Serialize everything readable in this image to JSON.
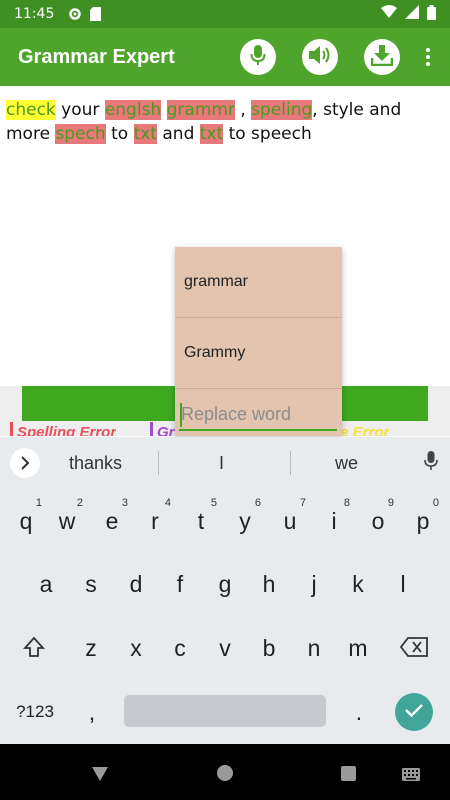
{
  "status_bar": {
    "time": "11:45"
  },
  "app": {
    "title": "Grammar Expert"
  },
  "editor": {
    "words": [
      {
        "text": "check",
        "hl": "yellow"
      },
      {
        "text": " your ",
        "hl": "none"
      },
      {
        "text": "englsh",
        "hl": "red"
      },
      {
        "text": " ",
        "hl": "none"
      },
      {
        "text": "grammr",
        "hl": "red"
      },
      {
        "text": " , ",
        "hl": "none"
      },
      {
        "text": "speling",
        "hl": "red"
      },
      {
        "text": ", style and more ",
        "hl": "none"
      },
      {
        "text": "spech",
        "hl": "red"
      },
      {
        "text": " to ",
        "hl": "none"
      },
      {
        "text": "txt",
        "hl": "red"
      },
      {
        "text": " and ",
        "hl": "none"
      },
      {
        "text": "txt",
        "hl": "red"
      },
      {
        "text": " to speech",
        "hl": "none"
      }
    ]
  },
  "legend": {
    "spelling": "Spelling Error",
    "grammar": "Gr",
    "style": "le Error"
  },
  "popup": {
    "suggestions": [
      "grammar",
      "Grammy"
    ],
    "replace_placeholder": "Replace word",
    "replace_value": ""
  },
  "keyboard": {
    "suggestions": [
      "thanks",
      "I",
      "we"
    ],
    "row1": [
      {
        "key": "q",
        "num": "1"
      },
      {
        "key": "w",
        "num": "2"
      },
      {
        "key": "e",
        "num": "3"
      },
      {
        "key": "r",
        "num": "4"
      },
      {
        "key": "t",
        "num": "5"
      },
      {
        "key": "y",
        "num": "6"
      },
      {
        "key": "u",
        "num": "7"
      },
      {
        "key": "i",
        "num": "8"
      },
      {
        "key": "o",
        "num": "9"
      },
      {
        "key": "p",
        "num": "0"
      }
    ],
    "row2": [
      "a",
      "s",
      "d",
      "f",
      "g",
      "h",
      "j",
      "k",
      "l"
    ],
    "row3": [
      "z",
      "x",
      "c",
      "v",
      "b",
      "n",
      "m"
    ],
    "symbols_label": "?123",
    "comma": ",",
    "period": "."
  },
  "colors": {
    "app_bar": "#4fa52c",
    "status_bar": "#3f8f22",
    "spelling_error": "#e8797a",
    "grammar_highlight": "#ffff33",
    "popup_bg": "#e3c4ae",
    "enter_button": "#41a59a"
  },
  "icons": [
    "settings-icon",
    "sd-card-icon",
    "wifi-icon",
    "signal-icon",
    "battery-icon",
    "microphone-icon",
    "speaker-icon",
    "download-icon",
    "overflow-menu-icon",
    "chevron-right-icon",
    "shift-icon",
    "backspace-icon",
    "check-icon",
    "nav-back-icon",
    "nav-home-icon",
    "nav-recents-icon",
    "keyboard-icon"
  ]
}
